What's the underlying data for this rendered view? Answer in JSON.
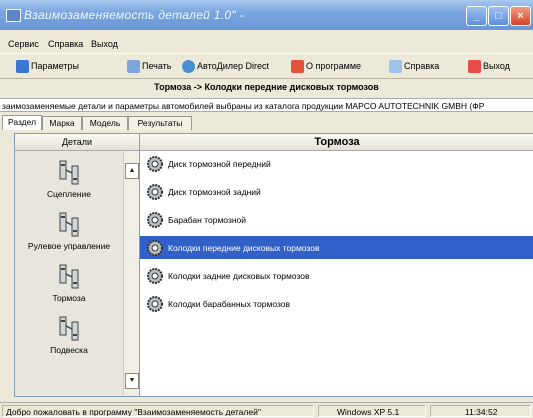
{
  "window": {
    "title": "Взаимозаменяемость деталей 1.0\" -",
    "minimize": "_",
    "maximize": "□",
    "close": "×"
  },
  "menu": [
    "Сервис",
    "Справка",
    "Выход"
  ],
  "toolbar": {
    "params": "Параметры",
    "print": "Печать",
    "dealer": "АвтоДилер Direct",
    "about": "О программе",
    "help": "Справка",
    "exit": "Выход"
  },
  "caption": "Тормоза -> Колодки передние дисковых тормозов",
  "info_line": "заимозаменяемые детали и параметры автомобилей выбраны из каталога продукции MAPCO AUTOTECHNIK GMBH (ФР",
  "tabs": [
    "Раздел",
    "Марка",
    "Модель",
    "Результаты"
  ],
  "left_panel": {
    "header": "Детали",
    "categories": [
      "Сцепление",
      "Рулевое управление",
      "Тормоза",
      "Подвеска"
    ]
  },
  "right_panel": {
    "header": "Тормоза",
    "items": [
      "Диск тормозной передний",
      "Диск тормозной задний",
      "Барабан тормозной",
      "Колодки передние дисковых тормозов",
      "Колодки задние дисковых тормозов",
      "Колодки барабанных тормозов"
    ],
    "selected_item": "Колодки передние дисковых тормозов"
  },
  "status": {
    "welcome": "Добро пожаловать в программу \"Взаимозаменяемость деталей\"",
    "os": "Windows XP  5.1",
    "time": "11:34:52"
  },
  "colors": {
    "selection": "#3161c8",
    "titlebar": "#7aa6e0",
    "window_bg": "#ece9d8"
  }
}
